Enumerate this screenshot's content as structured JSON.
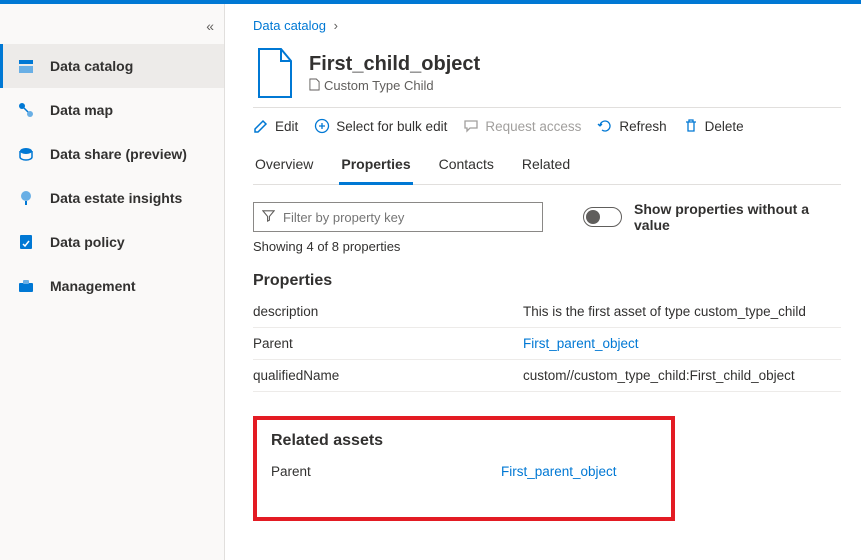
{
  "breadcrumb": {
    "root": "Data catalog"
  },
  "sidebar": {
    "items": [
      {
        "label": "Data catalog"
      },
      {
        "label": "Data map"
      },
      {
        "label": "Data share (preview)"
      },
      {
        "label": "Data estate insights"
      },
      {
        "label": "Data policy"
      },
      {
        "label": "Management"
      }
    ]
  },
  "asset": {
    "title": "First_child_object",
    "typeLabel": "Custom Type Child"
  },
  "toolbar": {
    "edit": "Edit",
    "bulk": "Select for bulk edit",
    "request": "Request access",
    "refresh": "Refresh",
    "delete": "Delete"
  },
  "tabs": {
    "overview": "Overview",
    "properties": "Properties",
    "contacts": "Contacts",
    "related": "Related"
  },
  "filter": {
    "placeholder": "Filter by property key",
    "toggleLabel": "Show properties without a value",
    "countLine": "Showing 4 of 8 properties"
  },
  "sections": {
    "properties": "Properties",
    "relatedAssets": "Related assets"
  },
  "properties": [
    {
      "key": "description",
      "value": "This is the first asset of type custom_type_child",
      "link": false
    },
    {
      "key": "Parent",
      "value": "First_parent_object",
      "link": true
    },
    {
      "key": "qualifiedName",
      "value": "custom//custom_type_child:First_child_object",
      "link": false
    }
  ],
  "relatedAssets": [
    {
      "key": "Parent",
      "value": "First_parent_object",
      "link": true
    }
  ]
}
